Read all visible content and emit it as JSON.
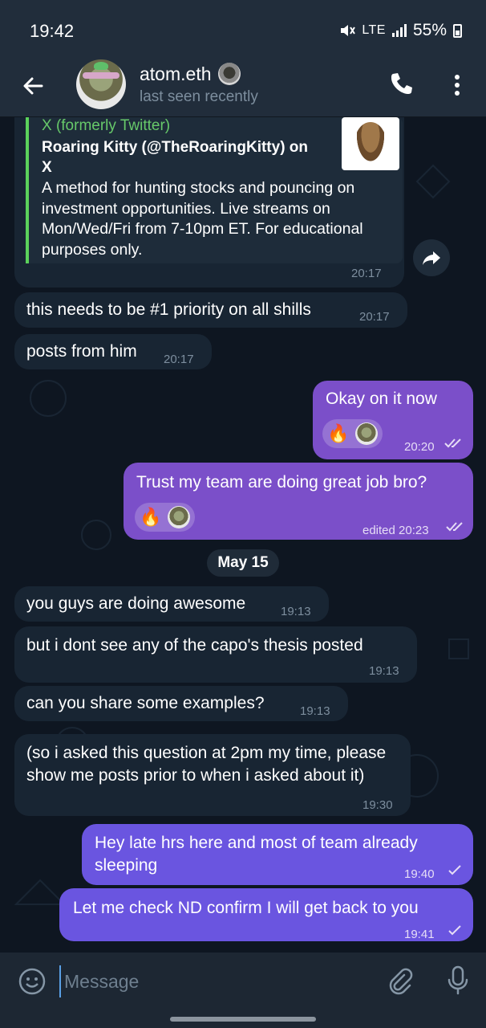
{
  "status_bar": {
    "time": "19:42",
    "network": "LTE",
    "battery": "55%"
  },
  "header": {
    "title": "atom.eth",
    "subtitle": "last seen recently"
  },
  "link_preview": {
    "site": "X (formerly Twitter)",
    "title": "Roaring Kitty (@TheRoaringKitty) on X",
    "description": "A method for hunting stocks and pouncing on investment opportunities. Live streams on Mon/Wed/Fri from 7-10pm ET. For educational purposes only.",
    "time": "20:17"
  },
  "messages": [
    {
      "text": "this needs to be #1 priority on all shills",
      "time": "20:17",
      "dir": "in"
    },
    {
      "text": "posts from him",
      "time": "20:17",
      "dir": "in"
    },
    {
      "text": "Okay on it now",
      "time": "20:20",
      "dir": "out",
      "reaction": "🔥"
    },
    {
      "text": "Trust my team are doing great job bro?",
      "time": "edited 20:23",
      "dir": "out",
      "reaction": "🔥"
    },
    {
      "text": "you guys are doing awesome",
      "time": "19:13",
      "dir": "in"
    },
    {
      "text": "but i dont see any of the capo's thesis posted",
      "time": "19:13",
      "dir": "in"
    },
    {
      "text": "can you share some examples?",
      "time": "19:13",
      "dir": "in"
    },
    {
      "text": "(so i asked this question at 2pm my time, please show me posts prior to when i asked about it)",
      "time": "19:30",
      "dir": "in"
    },
    {
      "text": "Hey late hrs here and most of team already sleeping",
      "time": "19:40",
      "dir": "out"
    },
    {
      "text": "Let me check ND confirm I will get back to you",
      "time": "19:41",
      "dir": "out"
    }
  ],
  "date_separator": "May 15",
  "composer": {
    "placeholder": "Message"
  },
  "icons": [
    "back-arrow-icon",
    "phone-icon",
    "more-vert-icon",
    "share-icon",
    "emoji-icon",
    "paperclip-icon",
    "microphone-icon"
  ],
  "colors": {
    "outgoing": "#7b4fc9",
    "incoming": "#182533",
    "background": "#0e1621"
  }
}
